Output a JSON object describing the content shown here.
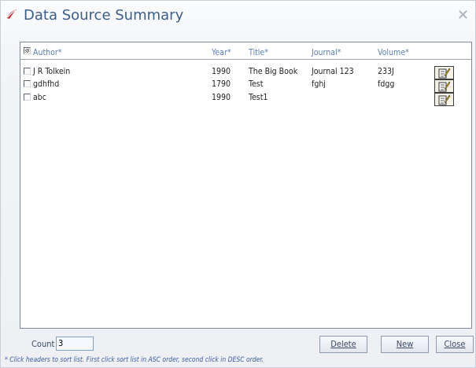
{
  "window": {
    "title": "Data Source Summary",
    "close_glyph": "✕"
  },
  "table": {
    "columns": [
      "Author*",
      "Year*",
      "Title*",
      "Journal*",
      "Volume*"
    ],
    "rows": [
      {
        "author": "J R Tolkein",
        "year": "1990",
        "title": "The Big Book",
        "journal": "Journal 123",
        "volume": "233J"
      },
      {
        "author": "gdhfhd",
        "year": "1790",
        "title": "Test",
        "journal": "fghj",
        "volume": "fdgg"
      },
      {
        "author": "abc",
        "year": "1990",
        "title": "Test1",
        "journal": "",
        "volume": ""
      }
    ]
  },
  "footer": {
    "count_label": "Count",
    "count_value": "3",
    "delete_label": "Delete",
    "new_label": "New",
    "close_label": "Close",
    "hint": "* Click headers to sort list. First click sort list in ASC order, second click in DESC order."
  },
  "icons": {
    "app": "app-logo-icon",
    "edit": "edit-note-icon"
  },
  "colors": {
    "title": "#3b5d89",
    "header": "#5b7fb3",
    "hint": "#3a5aa3"
  }
}
